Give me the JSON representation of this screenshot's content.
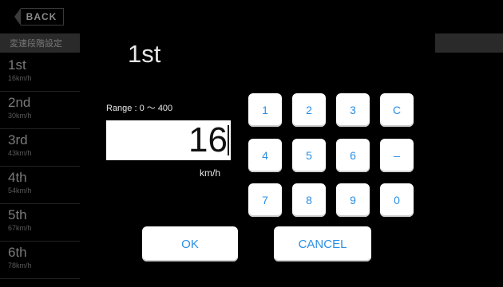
{
  "back": {
    "label": "BACK"
  },
  "header": {
    "label": "変速段階設定"
  },
  "gears": [
    {
      "name": "1st",
      "speed": "16km/h"
    },
    {
      "name": "2nd",
      "speed": "30km/h"
    },
    {
      "name": "3rd",
      "speed": "43km/h"
    },
    {
      "name": "4th",
      "speed": "54km/h"
    },
    {
      "name": "5th",
      "speed": "67km/h"
    },
    {
      "name": "6th",
      "speed": "78km/h"
    }
  ],
  "dialog": {
    "title": "1st",
    "range": "Range : 0 〜 400",
    "value": "16",
    "unit": "km/h",
    "keys": [
      "1",
      "2",
      "3",
      "C",
      "4",
      "5",
      "6",
      "–",
      "7",
      "8",
      "9",
      "0"
    ],
    "ok_label": "OK",
    "cancel_label": "CANCEL"
  },
  "colors": {
    "accent": "#2b8fe6",
    "background": "#000000",
    "key_bg": "#ffffff"
  }
}
